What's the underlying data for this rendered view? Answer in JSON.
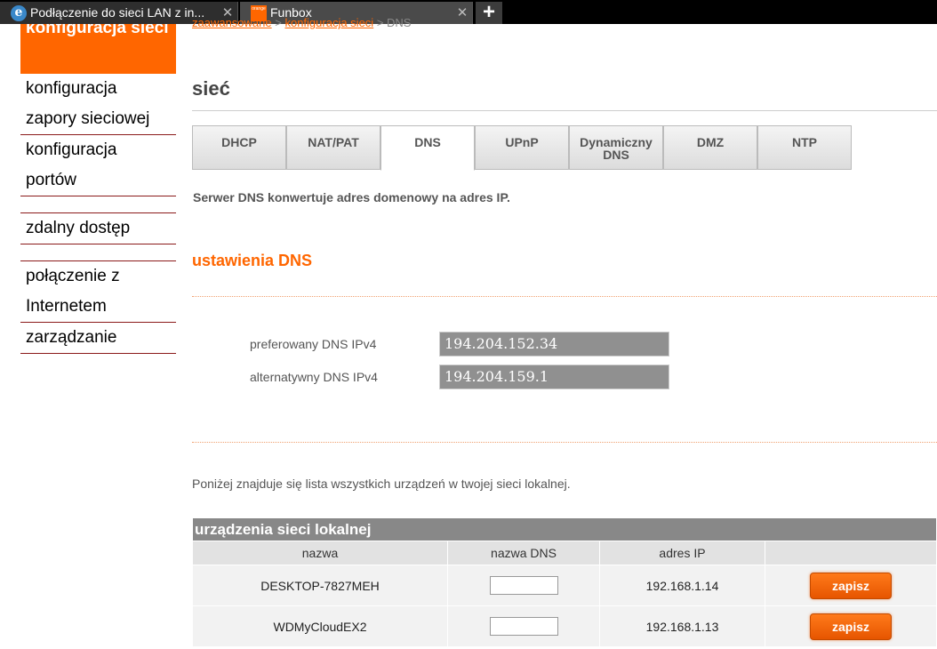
{
  "browser": {
    "tabs": [
      {
        "title": "Podłączenie do sieci LAN z in...",
        "favicon": "ie-icon"
      },
      {
        "title": "Funbox",
        "favicon": "orange-icon"
      }
    ],
    "new_tab_label": "+"
  },
  "sidebar": {
    "active": "konfiguracja sieci",
    "items": [
      "konfiguracja zapory sieciowej",
      "konfiguracja portów",
      "zdalny dostęp",
      "połączenie z Internetem",
      "zarządzanie"
    ]
  },
  "breadcrumb": {
    "first": "zaawansowane",
    "second": "konfiguracja sieci",
    "current": "DNS",
    "separator": ">"
  },
  "page_title": "sieć",
  "tabs": [
    "DHCP",
    "NAT/PAT",
    "DNS",
    "UPnP",
    "Dynamiczny DNS",
    "DMZ",
    "NTP"
  ],
  "active_tab": "DNS",
  "description": "Serwer DNS konwertuje adres domenowy na adres IP.",
  "dns_settings": {
    "title": "ustawienia DNS",
    "preferred_label": "preferowany DNS IPv4",
    "preferred_value": "194.204.152.34",
    "alternate_label": "alternatywny DNS IPv4",
    "alternate_value": "194.204.159.1"
  },
  "devices_info": "Poniżej znajduje się lista wszystkich urządzeń w twojej sieci lokalnej.",
  "devices_table": {
    "caption": "urządzenia sieci lokalnej",
    "headers": [
      "nazwa",
      "nazwa DNS",
      "adres IP",
      ""
    ],
    "rows": [
      {
        "name": "DESKTOP-7827MEH",
        "dns_name": "",
        "ip": "192.168.1.14",
        "button": "zapisz"
      },
      {
        "name": "WDMyCloudEX2",
        "dns_name": "",
        "ip": "192.168.1.13",
        "button": "zapisz"
      }
    ]
  },
  "colors": {
    "accent": "#ff6600",
    "nav_border": "#8b1a1a",
    "field_bg": "#909090"
  }
}
